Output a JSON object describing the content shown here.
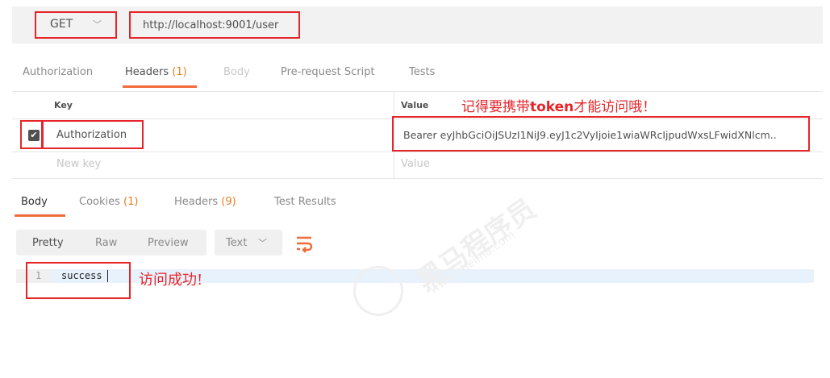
{
  "request": {
    "method": "GET",
    "url": "http://localhost:9001/user"
  },
  "request_tabs": {
    "authorization": "Authorization",
    "headers_label": "Headers",
    "headers_count": "(1)",
    "body": "Body",
    "prerequest": "Pre-request Script",
    "tests": "Tests"
  },
  "headers_table": {
    "key_header": "Key",
    "value_header": "Value",
    "rows": [
      {
        "key": "Authorization",
        "value": "Bearer eyJhbGciOiJSUzI1NiJ9.eyJ1c2VyIjoie1wiaWRcIjpudWxsLFwidXNlcm..",
        "checked": true
      }
    ],
    "new_key_placeholder": "New key",
    "new_value_placeholder": "Value"
  },
  "annotations": {
    "token_prefix": "记得要携带",
    "token_word": "token",
    "token_suffix": "才能访问哦！",
    "success_note": "访问成功!"
  },
  "response_tabs": {
    "body": "Body",
    "cookies_label": "Cookies",
    "cookies_count": "(1)",
    "headers_label": "Headers",
    "headers_count": "(9)",
    "test_results": "Test Results"
  },
  "response_toolbar": {
    "pretty": "Pretty",
    "raw": "Raw",
    "preview": "Preview",
    "format": "Text"
  },
  "response_body": {
    "lines": [
      {
        "number": "1",
        "text": "success"
      }
    ]
  },
  "watermark": {
    "text": "黑马程序员",
    "url": "www.itheima.com"
  },
  "colors": {
    "accent": "#f26b3a",
    "annotation_red": "#e5252a",
    "count_orange": "#e67e22"
  }
}
